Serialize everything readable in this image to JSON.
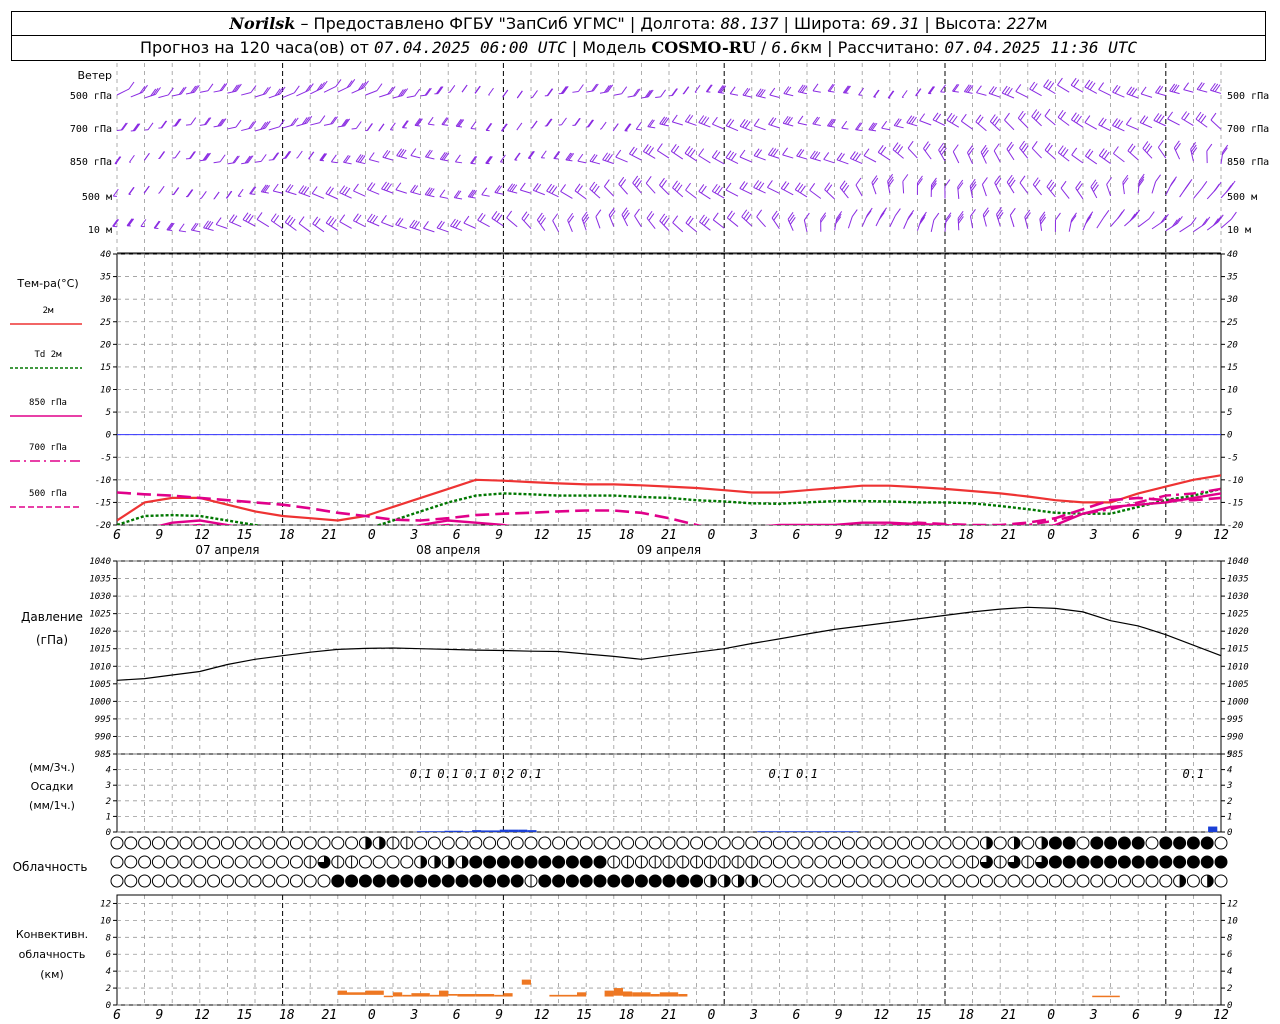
{
  "header": {
    "station": "Norilsk",
    "sep1": " – ",
    "provider": "Предоставлено ФГБУ \"ЗапСиб УГМС\"",
    "lon_label": " | Долгота: ",
    "lon_value": "88.137",
    "lat_label": " | Широта: ",
    "lat_value": "69.31",
    "alt_label": " | Высота: ",
    "alt_value": "227",
    "alt_unit": "м",
    "forecast_label": "Прогноз на 120 часа(ов) от ",
    "forecast_start": "07.04.2025 06:00 UTC",
    "model_label": "  | Модель ",
    "model_name": "COSMO-RU",
    "model_res_sep": " / ",
    "model_res": "6.6",
    "model_res_unit": "км",
    "calc_label": " | Рассчитано: ",
    "calc_time": "07.04.2025 11:36 UTC"
  },
  "time_axis": {
    "hour_labels": [
      "6",
      "9",
      "12",
      "15",
      "18",
      "21",
      "0",
      "3",
      "6",
      "9",
      "12",
      "15",
      "18",
      "21",
      "0",
      "3",
      "6",
      "9",
      "12",
      "15",
      "18",
      "21",
      "0",
      "3",
      "6",
      "9",
      "12"
    ],
    "date_labels": [
      "07 апреля",
      "08 апреля",
      "09 апреля"
    ]
  },
  "panels": {
    "wind": {
      "title": "Ветер",
      "levels": [
        "500 гПа",
        "700 гПа",
        "850 гПа",
        "500  м",
        "10  м"
      ]
    },
    "temperature": {
      "title": "Тем-ра(°C)",
      "legend": [
        "2м",
        "Td 2м",
        "850 гПа",
        "700 гПа",
        "500 гПа"
      ],
      "y_ticks": [
        "40",
        "35",
        "30",
        "25",
        "20",
        "15",
        "10",
        "5",
        "0",
        "-5",
        "-10",
        "-15",
        "-20"
      ]
    },
    "pressure": {
      "title": "Давление",
      "unit": "(гПа)",
      "y_ticks": [
        "1040",
        "1035",
        "1030",
        "1025",
        "1020",
        "1015",
        "1010",
        "1005",
        "1000",
        "995",
        "990",
        "985"
      ]
    },
    "precip": {
      "unit1": "(мм/3ч.)",
      "title": "Осадки",
      "unit2": "(мм/1ч.)",
      "y_ticks": [
        "5",
        "4",
        "3",
        "2",
        "1",
        "0"
      ]
    },
    "cloud": {
      "title": "Облачность"
    },
    "convective": {
      "title1": "Конвективн.",
      "title2": "облачность",
      "unit": "(км)",
      "y_ticks": [
        "12",
        "10",
        "8",
        "6",
        "4",
        "2",
        "0"
      ]
    }
  },
  "colors": {
    "t2m": "#ee3333",
    "td2m": "#007700",
    "t850": "#e0008a",
    "t700": "#e0008a",
    "t500": "#e0008a",
    "zero_line": "#3333ff",
    "wind": "#8a2be2",
    "precip": "#1a3fd6",
    "convective": "#ee7722",
    "pressure": "#000000"
  },
  "chart_data": [
    {
      "type": "line",
      "title": "Тем-ра(°C)",
      "x_hours_from_start": [
        0,
        3,
        6,
        9,
        12,
        15,
        18,
        21,
        24,
        27,
        30,
        33,
        36,
        39,
        42,
        45,
        48,
        51,
        54,
        57,
        60,
        63,
        66,
        69,
        72,
        75,
        78,
        81,
        84,
        87,
        90,
        93,
        96,
        99,
        102,
        105,
        108,
        111,
        114,
        117,
        120
      ],
      "ylim": [
        -20,
        40
      ],
      "series": [
        {
          "name": "2м",
          "values": [
            -19,
            -15,
            -14,
            -14,
            -15.5,
            -17,
            -18,
            -18.5,
            -19,
            -18,
            -16,
            -14,
            -12,
            -10,
            -10.2,
            -10.5,
            -10.8,
            -11,
            -11,
            -11.2,
            -11.5,
            -11.8,
            -12.3,
            -12.8,
            -12.8,
            -12.3,
            -11.8,
            -11.3,
            -11.3,
            -11.6,
            -12,
            -12.5,
            -13,
            -13.7,
            -14.5,
            -15,
            -15,
            -13,
            -11.5,
            -10,
            -9
          ]
        },
        {
          "name": "Td 2м",
          "values": [
            -20,
            -18,
            -17.8,
            -18,
            -19,
            -20,
            -21,
            -22,
            -22,
            -21,
            -19,
            -17,
            -15,
            -13.5,
            -13,
            -13.2,
            -13.5,
            -13.5,
            -13.5,
            -13.8,
            -14,
            -14.5,
            -14.8,
            -15.2,
            -15.3,
            -15,
            -14.7,
            -14.7,
            -14.8,
            -15,
            -15,
            -15.2,
            -15.8,
            -16.5,
            -17.3,
            -17.5,
            -17.5,
            -16,
            -14.5,
            -13.5,
            -12
          ]
        },
        {
          "name": "850 гПа",
          "values": [
            -23,
            -21,
            -19.5,
            -19,
            -20,
            -21,
            -22,
            -23,
            -24,
            -23,
            -21.5,
            -20,
            -19,
            -19.5,
            -20,
            -21,
            -21,
            -21.5,
            -22,
            -22.5,
            -22,
            -21.5,
            -21,
            -20.5,
            -20,
            -20,
            -20,
            -19.5,
            -19.5,
            -19.8,
            -20,
            -20.5,
            -21,
            -21,
            -20,
            -17.5,
            -16,
            -15.5,
            -15,
            -14,
            -13
          ]
        },
        {
          "name": "700 гПа",
          "values": [
            -24,
            -22,
            -20.5,
            -20,
            -21,
            -21.5,
            -22,
            -22.5,
            -23,
            -22,
            -21,
            -20.5,
            -20,
            -20.5,
            -21,
            -21,
            -21.5,
            -21.5,
            -22,
            -22,
            -21.5,
            -21,
            -21,
            -21,
            -21,
            -21,
            -21,
            -20.5,
            -20.5,
            -20.5,
            -20.5,
            -20.5,
            -20.5,
            -20,
            -19,
            -17.5,
            -16.5,
            -15,
            -13.5,
            -13,
            -12
          ]
        },
        {
          "name": "500 гПа",
          "values": [
            -12.8,
            -13.2,
            -13.5,
            -14,
            -14.5,
            -15,
            -15.5,
            -16.3,
            -17.3,
            -18,
            -18.8,
            -19,
            -18.5,
            -17.8,
            -17.5,
            -17.3,
            -17,
            -16.8,
            -16.8,
            -17.3,
            -18.5,
            -20,
            -21.5,
            -22,
            -22,
            -21.5,
            -21,
            -20.5,
            -20,
            -19.5,
            -19.8,
            -20,
            -20,
            -19.5,
            -18.5,
            -16.5,
            -14.5,
            -14,
            -14.5,
            -14.5,
            -14
          ]
        }
      ]
    },
    {
      "type": "line",
      "title": "Давление",
      "ylim": [
        985,
        1040
      ],
      "x_hours_from_start": [
        0,
        3,
        6,
        9,
        12,
        15,
        18,
        21,
        24,
        27,
        30,
        33,
        36,
        39,
        42,
        45,
        48,
        51,
        54,
        57,
        60,
        63,
        66,
        69,
        72,
        75,
        78,
        81,
        84,
        87,
        90,
        93,
        96,
        99,
        102,
        105,
        108,
        111,
        114,
        117,
        120
      ],
      "series": [
        {
          "name": "",
          "values": [
            1006,
            1006.5,
            1007.5,
            1008.5,
            1010.5,
            1012,
            1013,
            1014,
            1014.8,
            1015.1,
            1015.2,
            1015,
            1014.8,
            1014.6,
            1014.5,
            1014.3,
            1014.2,
            1013.5,
            1012.8,
            1012,
            1013,
            1014,
            1015,
            1016.5,
            1017.8,
            1019.2,
            1020.5,
            1021.5,
            1022.5,
            1023.5,
            1024.5,
            1025.5,
            1026.3,
            1026.8,
            1026.5,
            1025.5,
            1023,
            1021.5,
            1019,
            1016,
            1013
          ]
        }
      ]
    },
    {
      "type": "bar",
      "title": "Осадки",
      "ylim": [
        0,
        5
      ],
      "precip_labels": [
        {
          "hour": 33,
          "text": "0.1"
        },
        {
          "hour": 36,
          "text": "0.1"
        },
        {
          "hour": 39,
          "text": "0.1"
        },
        {
          "hour": 42,
          "text": "0.2"
        },
        {
          "hour": 45,
          "text": "0.1"
        },
        {
          "hour": 72,
          "text": "0.1"
        },
        {
          "hour": 75,
          "text": "0.1"
        },
        {
          "hour": 117,
          "text": "0.1"
        }
      ],
      "bars_hours": [
        33,
        34,
        35,
        36,
        37,
        38,
        39,
        40,
        41,
        42,
        43,
        44,
        45,
        70,
        71,
        72,
        73,
        74,
        75,
        76,
        77,
        78,
        79,
        80,
        119
      ],
      "bars_values": [
        0.05,
        0.05,
        0.05,
        0.08,
        0.08,
        0.05,
        0.12,
        0.1,
        0.1,
        0.15,
        0.15,
        0.15,
        0.12,
        0.05,
        0.05,
        0.05,
        0.05,
        0.05,
        0.05,
        0.05,
        0.05,
        0.05,
        0.05,
        0.05,
        0.35
      ]
    },
    {
      "type": "heatmap",
      "title": "Облачность",
      "rows_octas": [
        [
          2,
          0,
          0,
          0,
          0,
          0,
          0,
          0,
          0,
          0,
          0,
          0,
          0,
          0,
          0,
          0,
          0,
          0,
          0,
          0,
          0,
          0,
          0,
          0,
          0,
          0,
          0,
          0,
          0,
          0,
          0,
          0,
          0,
          0,
          0,
          0,
          0,
          0,
          0,
          0,
          0,
          0,
          0,
          0,
          0,
          0,
          0,
          0,
          0,
          0,
          0,
          0,
          0,
          0,
          0,
          0,
          0,
          0,
          0,
          0,
          0,
          0,
          0,
          0,
          0,
          0,
          0,
          0,
          0,
          0,
          0,
          0,
          0,
          0,
          0,
          0,
          0,
          0,
          0,
          0,
          0,
          0,
          0,
          0,
          0,
          0,
          0,
          0,
          0,
          0,
          0,
          0,
          0,
          0,
          0,
          0,
          0,
          0,
          0,
          0,
          0,
          0,
          0,
          0,
          0,
          0,
          0,
          0,
          0,
          0,
          0,
          0,
          0,
          0,
          0,
          0,
          0,
          0,
          0,
          0,
          0,
          0,
          0,
          0,
          0,
          0,
          0,
          0,
          0,
          0,
          0,
          0,
          0,
          0,
          0,
          0,
          0,
          0,
          0,
          0,
          0
        ],
        [
          0,
          0,
          0,
          0,
          0,
          0,
          0,
          0,
          0,
          0,
          0,
          0,
          0,
          0,
          0,
          0,
          0,
          0,
          0,
          0,
          0,
          0,
          0,
          0,
          0,
          0,
          0,
          0,
          0,
          0,
          0,
          0,
          0,
          0,
          0,
          0,
          0,
          0,
          0,
          0,
          0,
          0,
          0,
          0,
          0,
          0,
          0,
          0,
          0,
          0,
          0,
          0,
          0,
          0,
          0,
          0,
          0,
          0,
          0,
          0,
          0,
          0,
          0,
          0,
          0,
          0,
          0,
          0,
          0,
          0,
          0,
          0,
          0,
          0,
          0,
          0,
          0,
          0,
          0,
          0,
          0,
          0,
          0,
          0,
          0,
          0,
          0,
          0,
          0,
          0,
          0,
          0,
          0,
          0,
          0,
          0,
          0,
          0,
          0,
          0,
          0,
          0,
          0,
          0,
          0,
          0,
          0,
          0,
          0,
          0,
          0,
          0,
          0,
          0,
          0,
          0,
          0,
          0,
          0,
          0,
          0,
          0,
          0,
          0,
          0,
          0,
          0,
          0,
          0,
          0,
          0,
          0,
          0,
          0,
          0,
          0,
          0,
          0,
          0,
          0,
          0
        ],
        [
          0,
          0,
          0,
          0,
          0,
          0,
          0,
          0,
          0,
          0,
          0,
          0,
          0,
          0,
          0,
          0,
          0,
          0,
          0,
          0,
          0,
          0,
          0,
          0,
          0,
          0,
          0,
          0,
          0,
          0,
          0,
          0,
          0,
          0,
          0,
          0,
          0,
          0,
          0,
          0,
          0,
          0,
          0,
          0,
          0,
          0,
          0,
          0,
          0,
          0,
          0,
          0,
          0,
          0,
          0,
          0,
          0,
          0,
          0,
          0,
          0,
          0,
          0,
          0,
          0,
          0,
          0,
          0,
          0,
          0,
          0,
          0,
          0,
          0,
          0,
          0,
          0,
          0,
          0,
          0,
          0,
          0,
          0,
          0,
          0,
          0,
          0,
          0,
          0,
          0,
          0,
          0,
          0,
          0,
          0,
          0,
          0,
          0,
          0,
          0,
          0,
          0,
          0,
          0,
          0,
          0,
          0,
          0,
          0,
          0,
          0,
          0,
          0,
          0,
          0,
          0,
          0,
          0,
          0,
          0,
          0,
          0,
          0,
          0,
          0,
          0,
          0,
          0,
          0,
          0,
          0,
          0,
          0,
          0,
          0,
          0,
          0,
          0,
          0,
          0,
          0
        ]
      ]
    },
    {
      "type": "bar",
      "title": "Конвективн. облачность",
      "ylim": [
        0,
        13
      ],
      "segments": [
        {
          "start": 24,
          "end": 25,
          "base": 1.2,
          "top": 1.7
        },
        {
          "start": 25,
          "end": 27,
          "base": 1.2,
          "top": 1.5
        },
        {
          "start": 27,
          "end": 29,
          "base": 1.2,
          "top": 1.7
        },
        {
          "start": 29,
          "end": 30,
          "base": 1.0,
          "top": 1.1
        },
        {
          "start": 30,
          "end": 31,
          "base": 1.0,
          "top": 1.5
        },
        {
          "start": 31,
          "end": 32,
          "base": 1.0,
          "top": 1.2
        },
        {
          "start": 32,
          "end": 34,
          "base": 1.0,
          "top": 1.4
        },
        {
          "start": 34,
          "end": 35,
          "base": 1.0,
          "top": 1.2
        },
        {
          "start": 35,
          "end": 36,
          "base": 1.0,
          "top": 1.7
        },
        {
          "start": 36,
          "end": 37,
          "base": 1.1,
          "top": 1.3
        },
        {
          "start": 37,
          "end": 39,
          "base": 1.0,
          "top": 1.3
        },
        {
          "start": 39,
          "end": 41,
          "base": 1.0,
          "top": 1.3
        },
        {
          "start": 41,
          "end": 42,
          "base": 1.0,
          "top": 1.2
        },
        {
          "start": 42,
          "end": 43,
          "base": 1.0,
          "top": 1.4
        },
        {
          "start": 44,
          "end": 45,
          "base": 2.4,
          "top": 3.0
        },
        {
          "start": 47,
          "end": 50,
          "base": 1.0,
          "top": 1.2
        },
        {
          "start": 50,
          "end": 51,
          "base": 1.0,
          "top": 1.5
        },
        {
          "start": 53,
          "end": 54,
          "base": 1.0,
          "top": 1.7
        },
        {
          "start": 54,
          "end": 55,
          "base": 1.1,
          "top": 2.0
        },
        {
          "start": 55,
          "end": 56,
          "base": 1.0,
          "top": 1.6
        },
        {
          "start": 56,
          "end": 58,
          "base": 1.0,
          "top": 1.5
        },
        {
          "start": 58,
          "end": 59,
          "base": 1.0,
          "top": 1.3
        },
        {
          "start": 59,
          "end": 61,
          "base": 1.0,
          "top": 1.5
        },
        {
          "start": 61,
          "end": 62,
          "base": 1.0,
          "top": 1.3
        },
        {
          "start": 106,
          "end": 109,
          "base": 1.0,
          "top": 1.1
        }
      ]
    }
  ]
}
